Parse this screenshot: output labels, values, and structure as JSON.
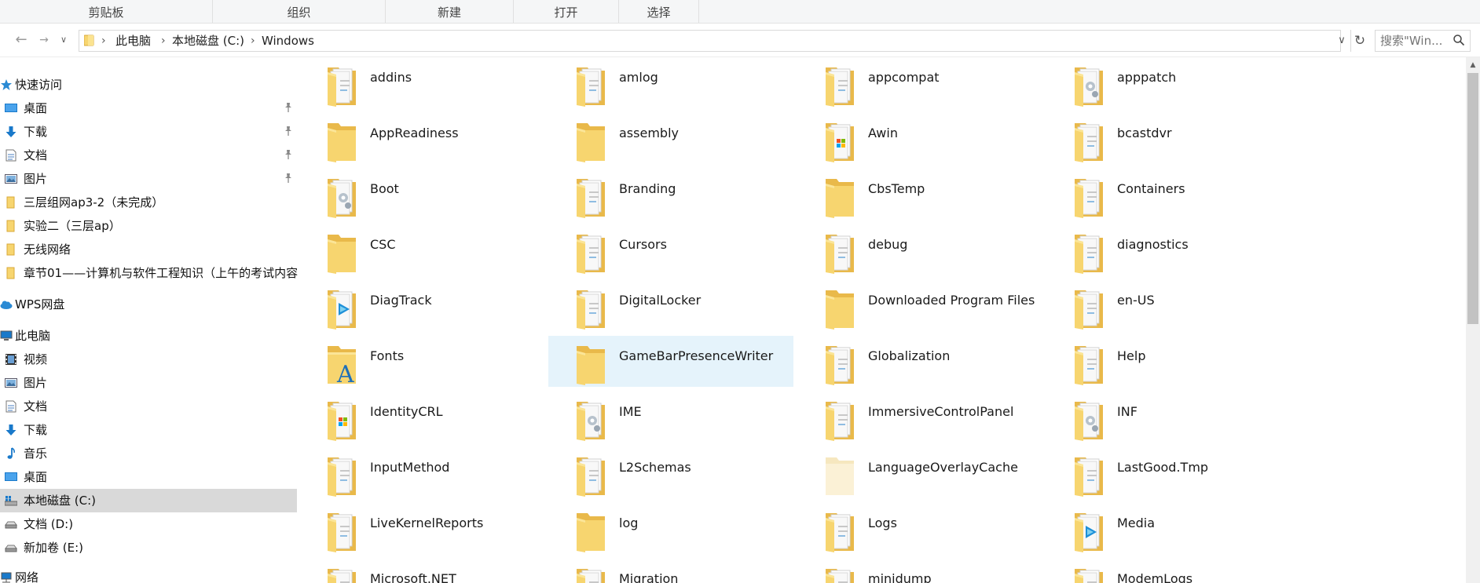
{
  "ribbon": {
    "groups": [
      "剪贴板",
      "组织",
      "新建",
      "打开",
      "选择"
    ]
  },
  "address": {
    "path": [
      "此电脑",
      "本地磁盘 (C:)",
      "Windows"
    ],
    "search_placeholder": "搜索\"Win..."
  },
  "sidebar": {
    "items": [
      {
        "label": "快速访问",
        "icon": "star-icon"
      },
      {
        "label": "桌面",
        "icon": "desktop-icon",
        "pinned": true
      },
      {
        "label": "下载",
        "icon": "download-icon",
        "pinned": true
      },
      {
        "label": "文档",
        "icon": "document-icon",
        "pinned": true
      },
      {
        "label": "图片",
        "icon": "picture-icon",
        "pinned": true
      },
      {
        "label": "三层组网ap3-2（未完成）",
        "icon": "folder-icon"
      },
      {
        "label": "实验二（三层ap）",
        "icon": "folder-icon"
      },
      {
        "label": "无线网络",
        "icon": "folder-icon"
      },
      {
        "label": "章节01——计算机与软件工程知识（上午的考试内容",
        "icon": "folder-icon"
      },
      {
        "label": "WPS网盘",
        "icon": "cloud-icon"
      },
      {
        "label": "此电脑",
        "icon": "computer-icon"
      },
      {
        "label": "视频",
        "icon": "video-icon"
      },
      {
        "label": "图片",
        "icon": "picture-icon"
      },
      {
        "label": "文档",
        "icon": "document-icon"
      },
      {
        "label": "下载",
        "icon": "download-icon"
      },
      {
        "label": "音乐",
        "icon": "music-icon"
      },
      {
        "label": "桌面",
        "icon": "desktop-icon"
      },
      {
        "label": "本地磁盘 (C:)",
        "icon": "windows-drive-icon",
        "selected": true
      },
      {
        "label": "文档 (D:)",
        "icon": "drive-icon"
      },
      {
        "label": "新加卷 (E:)",
        "icon": "drive-icon"
      },
      {
        "label": "网络",
        "icon": "network-icon"
      }
    ]
  },
  "folders": [
    {
      "name": "addins",
      "icon": "folder-docs-icon"
    },
    {
      "name": "amlog",
      "icon": "folder-docs-icon"
    },
    {
      "name": "appcompat",
      "icon": "folder-docs-icon"
    },
    {
      "name": "apppatch",
      "icon": "folder-gear-icon"
    },
    {
      "name": "AppReadiness",
      "icon": "folder-icon"
    },
    {
      "name": "assembly",
      "icon": "folder-icon"
    },
    {
      "name": "Awin",
      "icon": "folder-windows-icon"
    },
    {
      "name": "bcastdvr",
      "icon": "folder-docs-icon"
    },
    {
      "name": "Boot",
      "icon": "folder-gear-icon"
    },
    {
      "name": "Branding",
      "icon": "folder-docs-icon"
    },
    {
      "name": "CbsTemp",
      "icon": "folder-icon"
    },
    {
      "name": "Containers",
      "icon": "folder-docs-icon"
    },
    {
      "name": "CSC",
      "icon": "folder-icon"
    },
    {
      "name": "Cursors",
      "icon": "folder-docs-icon"
    },
    {
      "name": "debug",
      "icon": "folder-docs-icon"
    },
    {
      "name": "diagnostics",
      "icon": "folder-docs-icon"
    },
    {
      "name": "DiagTrack",
      "icon": "folder-media-icon"
    },
    {
      "name": "DigitalLocker",
      "icon": "folder-docs-icon"
    },
    {
      "name": "Downloaded Program Files",
      "icon": "folder-icon"
    },
    {
      "name": "en-US",
      "icon": "folder-docs-icon"
    },
    {
      "name": "Fonts",
      "icon": "folder-font-icon"
    },
    {
      "name": "GameBarPresenceWriter",
      "icon": "folder-icon",
      "selected": true
    },
    {
      "name": "Globalization",
      "icon": "folder-docs-icon"
    },
    {
      "name": "Help",
      "icon": "folder-docs-icon"
    },
    {
      "name": "IdentityCRL",
      "icon": "folder-windows-icon"
    },
    {
      "name": "IME",
      "icon": "folder-gear-icon"
    },
    {
      "name": "ImmersiveControlPanel",
      "icon": "folder-docs-icon"
    },
    {
      "name": "INF",
      "icon": "folder-gear-icon"
    },
    {
      "name": "InputMethod",
      "icon": "folder-docs-icon"
    },
    {
      "name": "L2Schemas",
      "icon": "folder-docs-icon"
    },
    {
      "name": "LanguageOverlayCache",
      "icon": "folder-hidden-icon"
    },
    {
      "name": "LastGood.Tmp",
      "icon": "folder-docs-icon"
    },
    {
      "name": "LiveKernelReports",
      "icon": "folder-docs-icon"
    },
    {
      "name": "log",
      "icon": "folder-icon"
    },
    {
      "name": "Logs",
      "icon": "folder-docs-icon"
    },
    {
      "name": "Media",
      "icon": "folder-media-icon"
    },
    {
      "name": "Microsoft.NET",
      "icon": "folder-docs-icon"
    },
    {
      "name": "Migration",
      "icon": "folder-docs-icon"
    },
    {
      "name": "minidump",
      "icon": "folder-docs-icon"
    },
    {
      "name": "ModemLogs",
      "icon": "folder-docs-icon"
    }
  ],
  "colors": {
    "selected_tile": "#e5f3fb",
    "selected_nav": "#d9d9d9",
    "folder_yellow": "#f7d56f"
  }
}
